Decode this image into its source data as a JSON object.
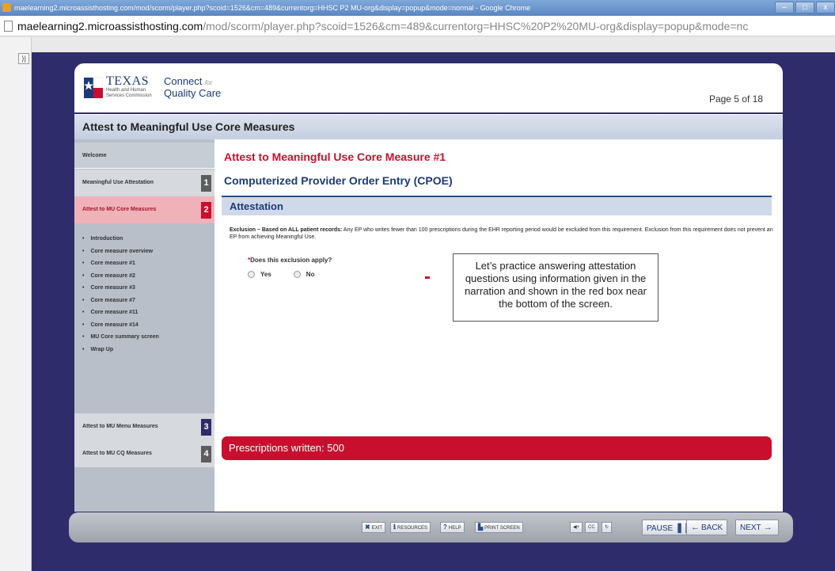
{
  "window": {
    "title": "maelearning2.microassisthosting.com/mod/scorm/player.php?scoid=1526&cm=489&currentorg=HHSC P2 MU-org&display=popup&mode=normal - Google Chrome",
    "controls": [
      "–",
      "□",
      "x"
    ]
  },
  "address": {
    "host": "maelearning2.microassisthosting.com",
    "path": "/mod/scorm/player.php?scoid=1526&cm=489&currentorg=HHSC%20P2%20MU-org&display=popup&mode=nc"
  },
  "gutter": {
    "toggle_label": "⟩|"
  },
  "header": {
    "logo_texas": "TEXAS",
    "logo_sub": "Health and Human Services Commission",
    "logo_connect": "Connect",
    "logo_for": "for",
    "logo_quality": "Quality Care",
    "page_count": "Page 5 of 18"
  },
  "title_strip": "Attest to Meaningful Use Core Measures",
  "sidebar": {
    "welcome": "Welcome",
    "sections": [
      {
        "label": "Meaningful Use Attestation",
        "number": "1"
      },
      {
        "label": "Attest to MU Core Measures",
        "number": "2"
      },
      {
        "label": "Attest to MU Menu Measures",
        "number": "3"
      },
      {
        "label": "Attest to MU CQ Measures",
        "number": "4"
      }
    ],
    "subitems": [
      "Introduction",
      "Core measure overview",
      "Core measure #1",
      "Core measure #2",
      "Core measure #3",
      "Core measure #7",
      "Core measure #11",
      "Core measure #14",
      "MU Core summary screen",
      "Wrap Up"
    ]
  },
  "content": {
    "measure_title": "Attest to Meaningful Use Core Measure #1",
    "measure_name": "Computerized Provider Order Entry (CPOE)",
    "attestation_heading": "Attestation",
    "exclusion_bold": "Exclusion – Based on ALL patient records:",
    "exclusion_text": " Any EP who writes fewer than 100 prescriptions during the EHR reporting period would be excluded from this requirement. Exclusion from this requirement does not prevent an EP from achieving Meaningful Use.",
    "question_required": "*",
    "question": "Does this exclusion apply?",
    "option_yes": "Yes",
    "option_no": "No",
    "callout": "Let’s practice answering attestation questions using information given in the narration and shown in the red box near the bottom of the screen.",
    "prescriptions": "Prescriptions written: 500"
  },
  "footer": {
    "exit": "EXIT",
    "resources": "RESOURCES",
    "help": "HELP",
    "print": "PRINT SCREEN",
    "audio": "◀+",
    "cc": "CC",
    "replay": "↻",
    "pause": "PAUSE",
    "back": "BACK",
    "next": "NEXT"
  }
}
